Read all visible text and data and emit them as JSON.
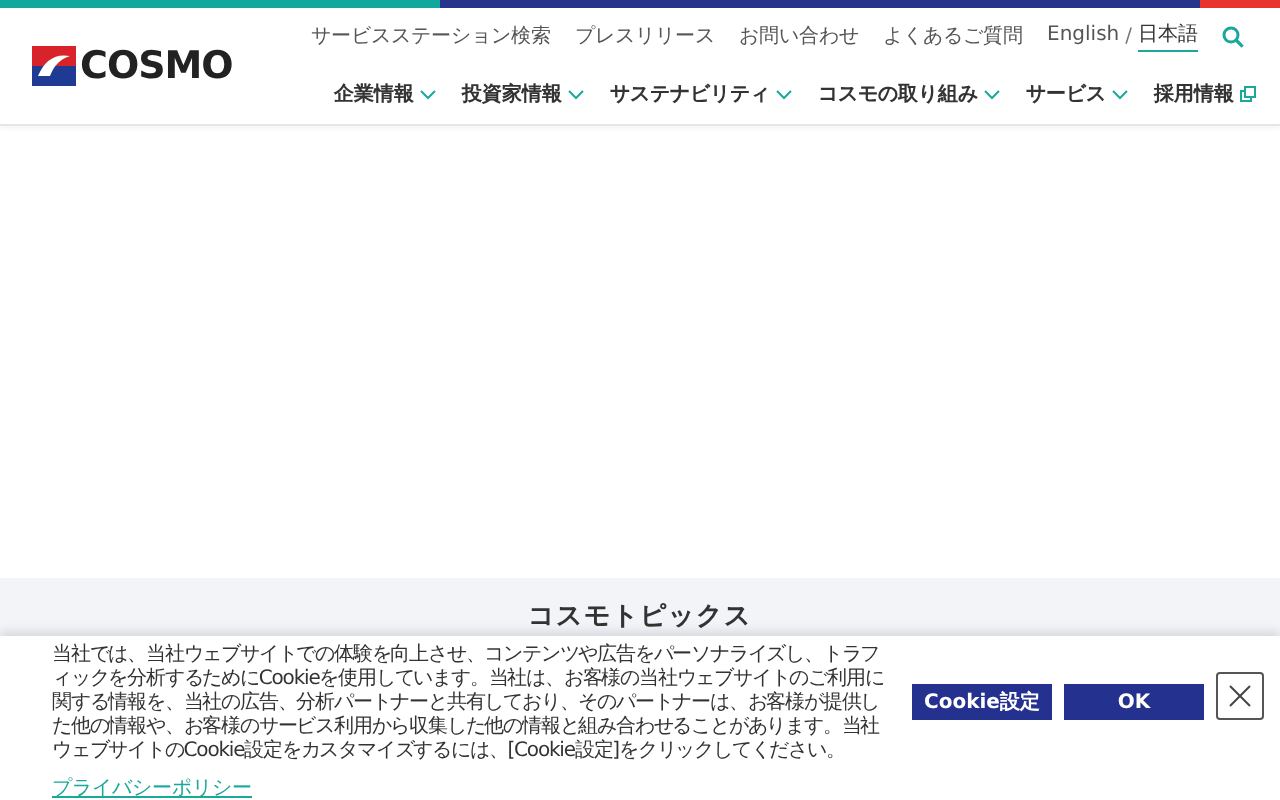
{
  "logo": {
    "text": "COSMO"
  },
  "top_links": [
    "サービスステーション検索",
    "プレスリリース",
    "お問い合わせ",
    "よくあるご質問"
  ],
  "languages": [
    {
      "label": "English",
      "selected": false
    },
    {
      "label": "日本語",
      "selected": true
    }
  ],
  "language_separator": "/",
  "nav": [
    {
      "label": "企業情報",
      "kind": "dropdown"
    },
    {
      "label": "投資家情報",
      "kind": "dropdown"
    },
    {
      "label": "サステナビリティ",
      "kind": "dropdown"
    },
    {
      "label": "コスモの取り組み",
      "kind": "dropdown"
    },
    {
      "label": "サービス",
      "kind": "dropdown"
    },
    {
      "label": "採用情報",
      "kind": "external"
    }
  ],
  "section_heading": "コスモトピックス",
  "cookie_banner": {
    "text": "当社では、当社ウェブサイトでの体験を向上させ、コンテンツや広告をパーソナライズし、トラフィックを分析するためにCookieを使用しています。当社は、お客様の当社ウェブサイトのご利用に関する情報を、当社の広告、分析パートナーと共有しており、そのパートナーは、お客様が提供した他の情報や、お客様のサービス利用から収集した他の情報と組み合わせることがあります。当社ウェブサイトのCookie設定をカスタマイズするには、[Cookie設定]をクリックしてください。",
    "privacy_link": "プライバシーポリシー",
    "buttons": [
      "Cookie設定",
      "OK"
    ]
  }
}
